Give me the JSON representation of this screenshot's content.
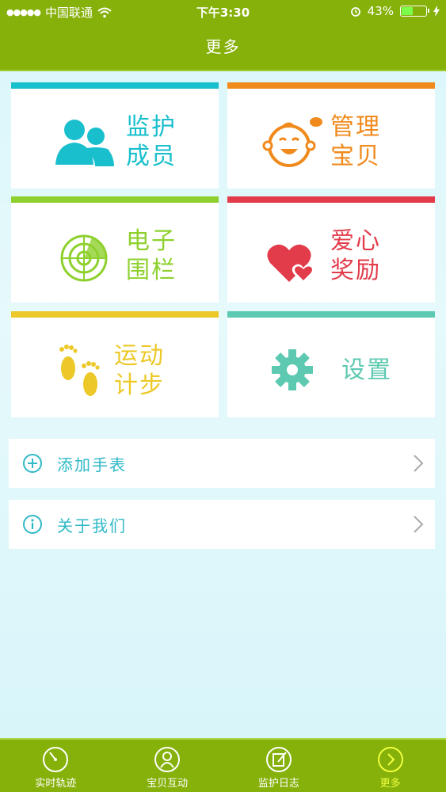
{
  "status_bar": {
    "carrier": "中国联通",
    "time": "下午3:30",
    "battery": "43%",
    "battery_level": 0.43
  },
  "header": {
    "title": "更多"
  },
  "tiles": [
    {
      "line1": "监护",
      "line2": "成员",
      "color": "#19bfcd",
      "icon": "people-icon"
    },
    {
      "line1": "管理",
      "line2": "宝贝",
      "color": "#f08a1c",
      "icon": "baby-face-icon"
    },
    {
      "line1": "电子",
      "line2": "围栏",
      "color": "#8ed12e",
      "icon": "radar-icon"
    },
    {
      "line1": "爱心",
      "line2": "奖励",
      "color": "#e23b4a",
      "icon": "hearts-icon"
    },
    {
      "line1": "运动",
      "line2": "计步",
      "color": "#ecc928",
      "icon": "footprints-icon"
    },
    {
      "line1": "设置",
      "color": "#5ec9b1",
      "icon": "gear-icon"
    }
  ],
  "list": [
    {
      "label": "添加手表",
      "icon": "plus-circle-icon"
    },
    {
      "label": "关于我们",
      "icon": "info-circle-icon"
    }
  ],
  "tabbar": [
    {
      "label": "实时轨迹",
      "icon": "clock-icon",
      "active": false
    },
    {
      "label": "宝贝互动",
      "icon": "child-icon",
      "active": false
    },
    {
      "label": "监护日志",
      "icon": "notepad-icon",
      "active": false
    },
    {
      "label": "更多",
      "icon": "chevron-circle-icon",
      "active": true
    }
  ],
  "colors": {
    "brand_green": "#86b10a",
    "accent_teal": "#2fb9c6",
    "active_tab": "#f0ff40"
  }
}
